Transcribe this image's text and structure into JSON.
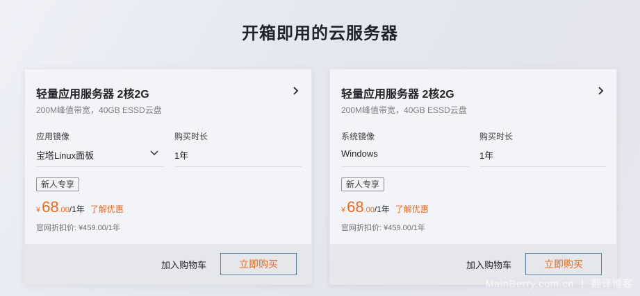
{
  "page": {
    "title": "开箱即用的云服务器"
  },
  "cards": [
    {
      "title": "轻量应用服务器 2核2G",
      "spec": "200M峰值带宽，40GB ESSD云盘",
      "image_label": "应用镜像",
      "image_value": "宝塔Linux面板",
      "duration_label": "购买时长",
      "duration_value": "1年",
      "tag": "新人专享",
      "price_currency": "¥",
      "price_int": "68",
      "price_dec": ".00",
      "price_unit": "/1年",
      "promo_link": "了解优惠",
      "original_price": "官网折扣价: ¥459.00/1年",
      "add_to_cart": "加入购物车",
      "buy_now": "立即购买"
    },
    {
      "title": "轻量应用服务器 2核2G",
      "spec": "200M峰值带宽，40GB ESSD云盘",
      "image_label": "系统镜像",
      "image_value": "Windows",
      "duration_label": "购买时长",
      "duration_value": "1年",
      "tag": "新人专享",
      "price_currency": "¥",
      "price_int": "68",
      "price_dec": ".00",
      "price_unit": "/1年",
      "promo_link": "了解优惠",
      "original_price": "官网折扣价: ¥459.00/1年",
      "add_to_cart": "加入购物车",
      "buy_now": "立即购买"
    }
  ],
  "watermark": "MainBerry.com.cn 丨 翻译博客",
  "colors": {
    "accent": "#ef6a1f",
    "button_border": "#5b7fa8"
  }
}
